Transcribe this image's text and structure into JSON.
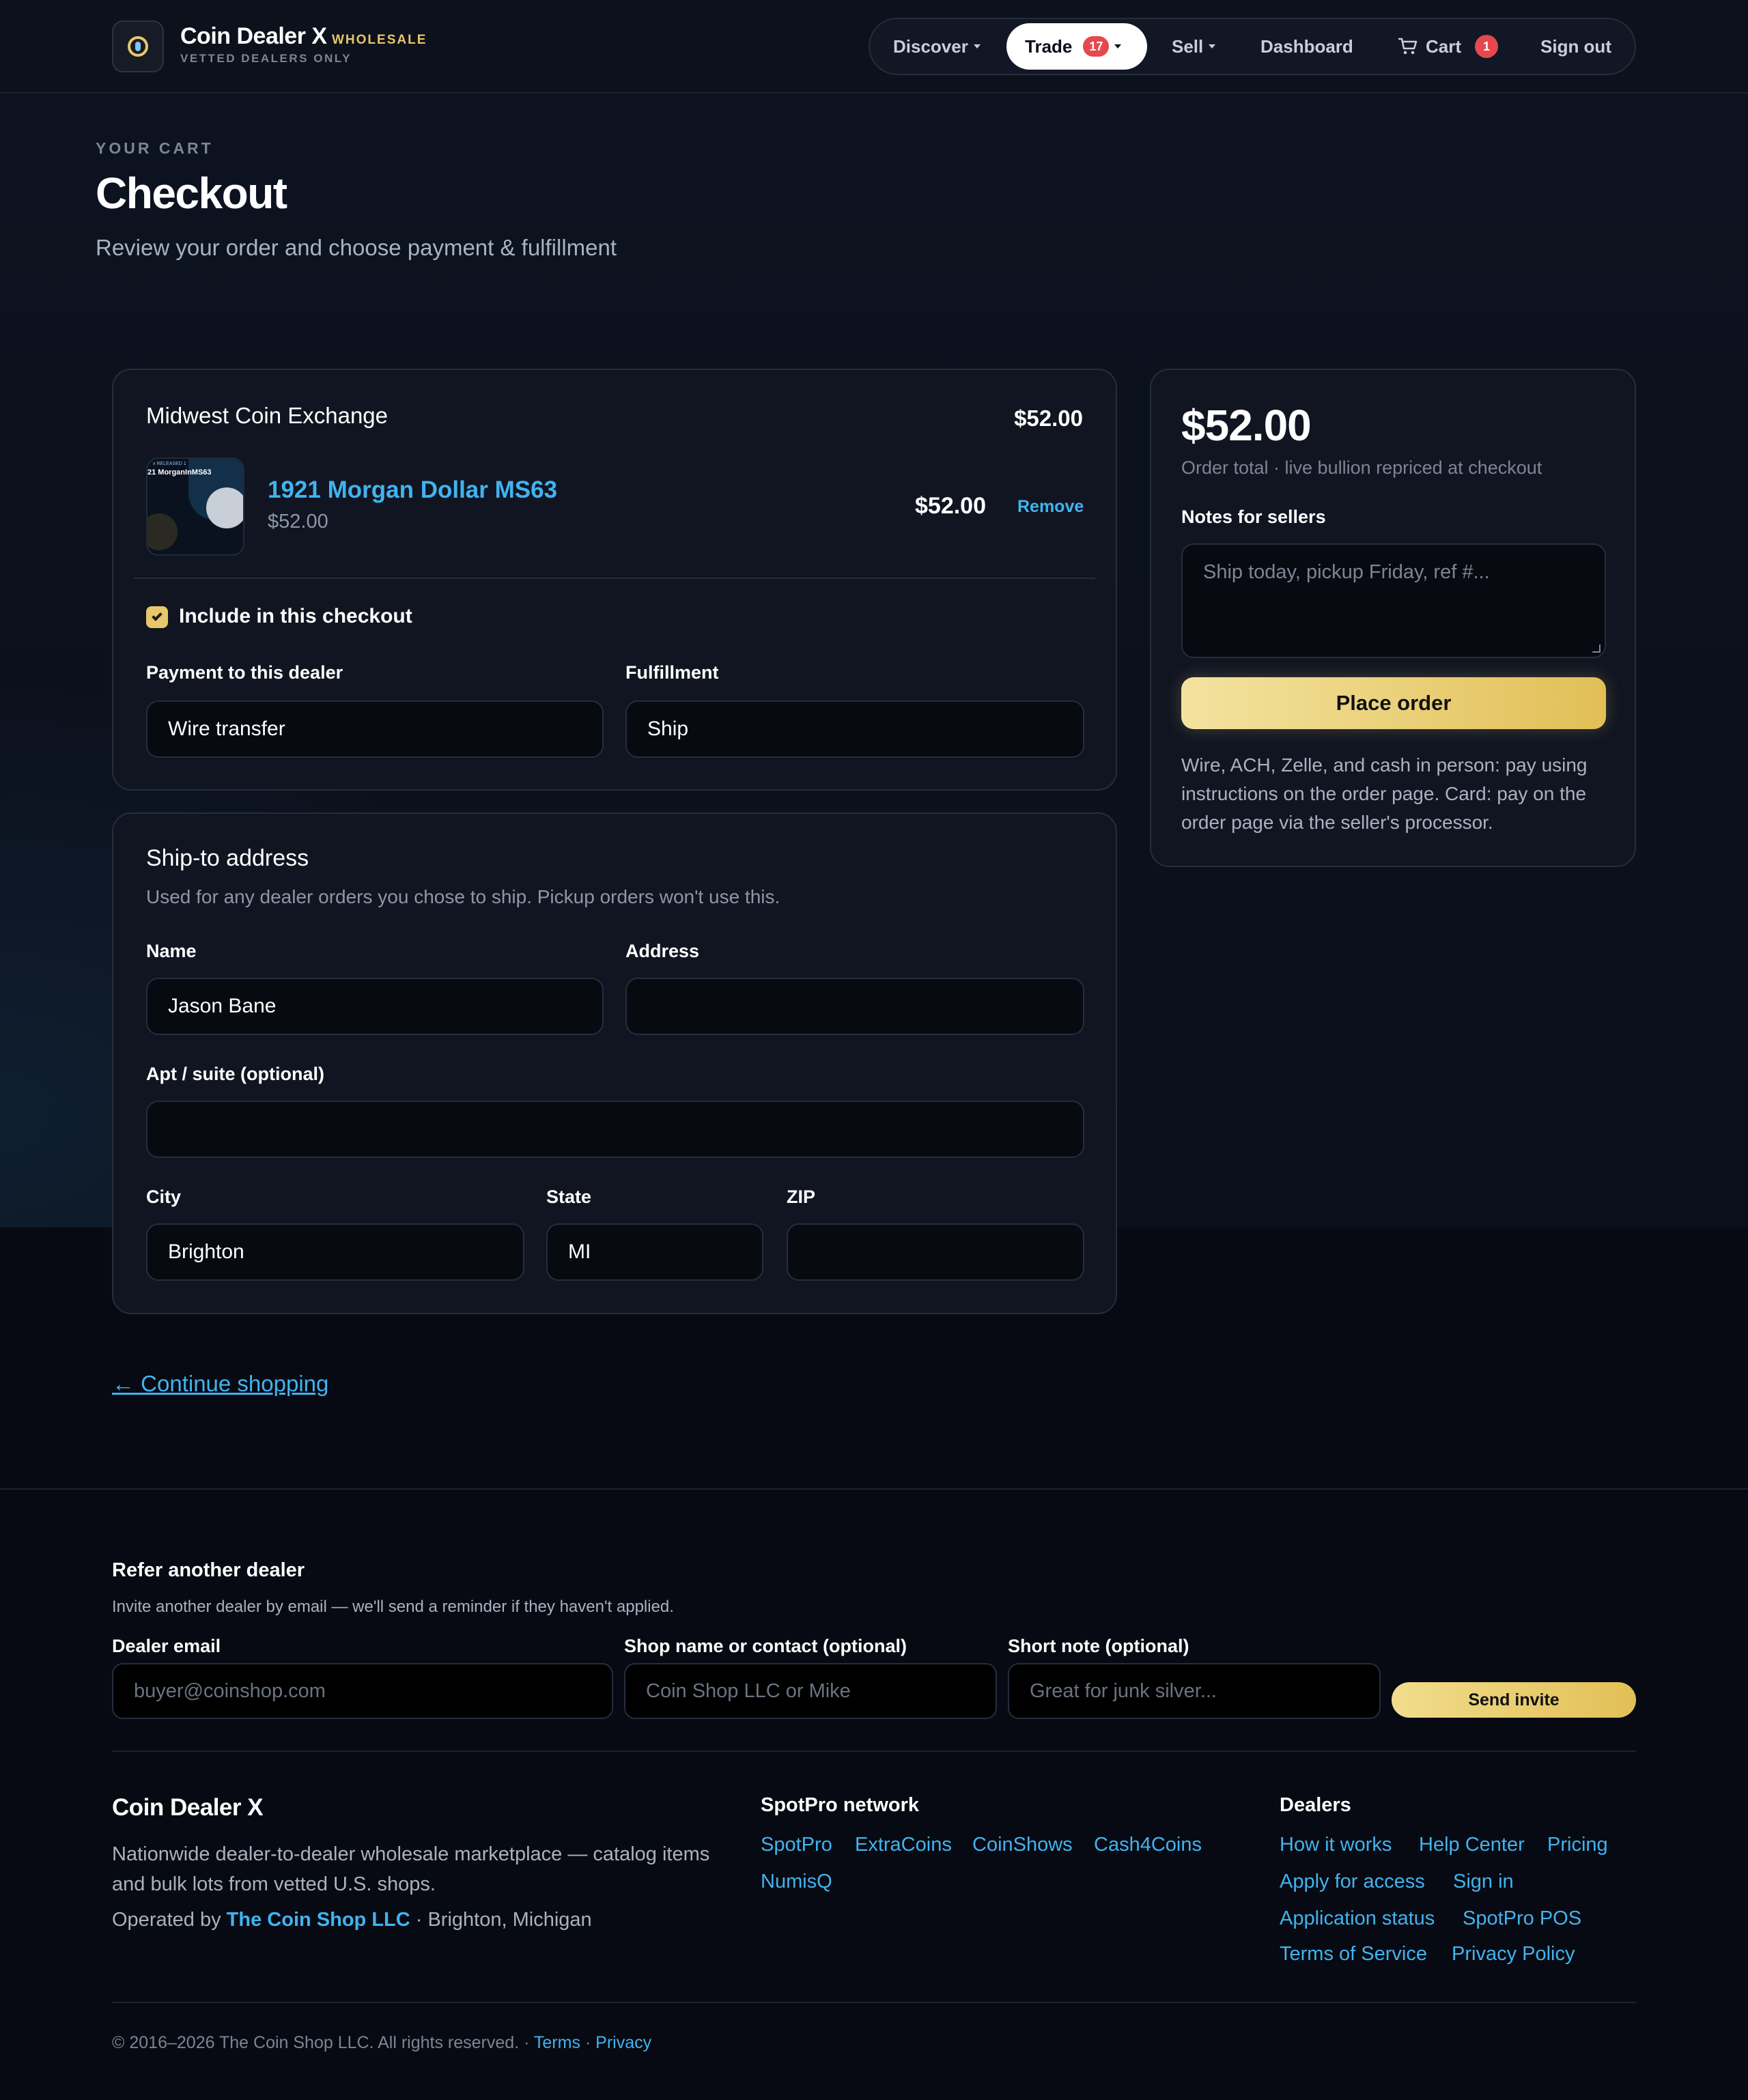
{
  "brand": {
    "name": "Coin Dealer X",
    "tag": "WHOLESALE",
    "sub": "VETTED DEALERS ONLY"
  },
  "nav": {
    "discover": "Discover",
    "trade": "Trade",
    "trade_badge": "17",
    "sell": "Sell",
    "dashboard": "Dashboard",
    "cart": "Cart",
    "cart_badge": "1",
    "signout": "Sign out"
  },
  "page": {
    "eyebrow": "YOUR CART",
    "title": "Checkout",
    "subtitle": "Review your order and choose payment & fulfillment"
  },
  "dealer": {
    "name": "Midwest Coin Exchange",
    "total": "$52.00",
    "item": {
      "title": "1921 Morgan Dollar MS63",
      "sub_price": "$52.00",
      "price": "$52.00",
      "remove": "Remove",
      "thumb_text": "21 MorganInMS63",
      "thumb_top": "x RELEASED 1"
    },
    "include_label": "Include in this checkout",
    "payment_label": "Payment to this dealer",
    "payment_value": "Wire transfer",
    "fulfillment_label": "Fulfillment",
    "fulfillment_value": "Ship"
  },
  "ship": {
    "title": "Ship-to address",
    "subtitle": "Used for any dealer orders you chose to ship. Pickup orders won't use this.",
    "name_label": "Name",
    "name_value": "Jason Bane",
    "address_label": "Address",
    "address_value": "",
    "apt_label": "Apt / suite (optional)",
    "apt_value": "",
    "city_label": "City",
    "city_value": "Brighton",
    "state_label": "State",
    "state_value": "MI",
    "zip_label": "ZIP",
    "zip_value": ""
  },
  "summary": {
    "total": "$52.00",
    "sub": "Order total · live bullion repriced at checkout",
    "notes_label": "Notes for sellers",
    "notes_placeholder": "Ship today, pickup Friday, ref #...",
    "place_order": "Place order",
    "note": "Wire, ACH, Zelle, and cash in person: pay using instructions on the order page. Card: pay on the order page via the seller's processor."
  },
  "continue": "← Continue shopping",
  "refer": {
    "title": "Refer another dealer",
    "sub": "Invite another dealer by email — we'll send a reminder if they haven't applied.",
    "email_label": "Dealer email",
    "email_placeholder": "buyer@coinshop.com",
    "shop_label": "Shop name or contact (optional)",
    "shop_placeholder": "Coin Shop LLC or Mike",
    "note_label": "Short note (optional)",
    "note_placeholder": "Great for junk silver...",
    "send": "Send invite"
  },
  "footer": {
    "brand": "Coin Dealer X",
    "desc": "Nationwide dealer-to-dealer wholesale marketplace — catalog items and bulk lots from vetted U.S. shops.",
    "op_prefix": "Operated by",
    "op_link": "The Coin Shop LLC",
    "op_suffix": "· Brighton, Michigan",
    "network_title": "SpotPro network",
    "network_links": [
      "SpotPro",
      "ExtraCoins",
      "CoinShows",
      "Cash4Coins",
      "NumisQ"
    ],
    "dealers_title": "Dealers",
    "dealers_links": [
      "How it works",
      "Help Center",
      "Pricing",
      "Apply for access",
      "Sign in",
      "Application status",
      "SpotPro POS",
      "Terms of Service",
      "Privacy Policy"
    ],
    "copyright": "© 2016–2026 The Coin Shop LLC. All rights reserved. ·",
    "terms": "Terms",
    "privacy": "Privacy"
  },
  "colors": {
    "accent": "#41b3f0",
    "gold": "#e8c76a",
    "badge": "#e5484d",
    "bg": "#0b0f19"
  }
}
